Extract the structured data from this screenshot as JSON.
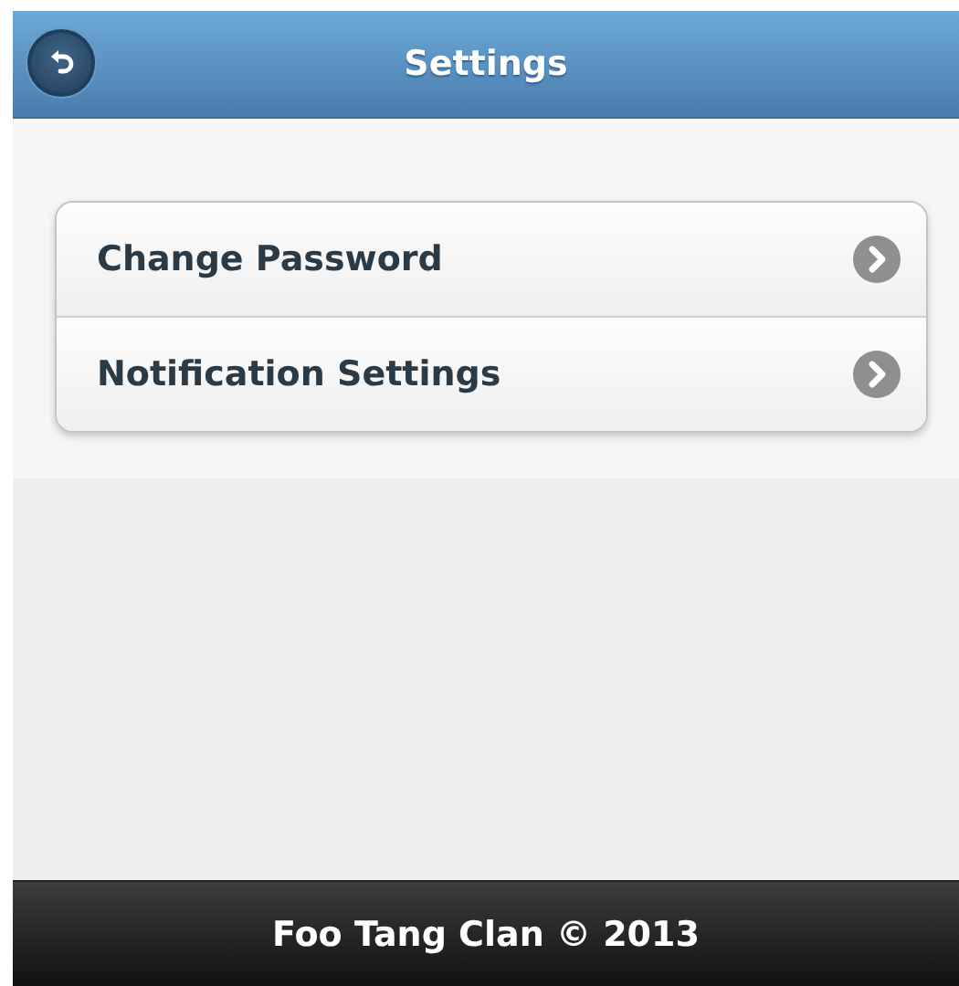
{
  "header": {
    "title": "Settings"
  },
  "menu": [
    {
      "label": "Change Password"
    },
    {
      "label": "Notification Settings"
    }
  ],
  "footer": {
    "text": "Foo Tang Clan © 2013"
  }
}
